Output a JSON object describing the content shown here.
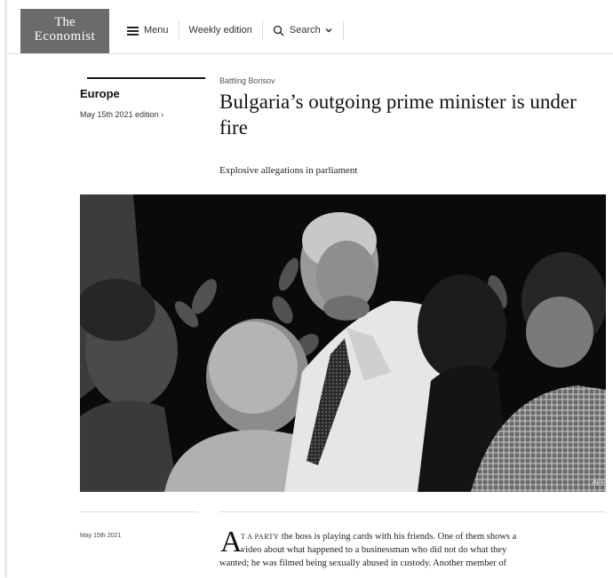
{
  "header": {
    "logo_line1": "The",
    "logo_line2": "Economist",
    "menu_label": "Menu",
    "weekly_label": "Weekly edition",
    "search_label": "Search"
  },
  "section": {
    "name": "Europe",
    "edition": "May 15th 2021 edition ›"
  },
  "article": {
    "rubric": "Battling Borisov",
    "headline": "Bulgaria’s outgoing prime minister is under fire",
    "standfirst": "Explosive allegations in parliament",
    "photo_credit": "AFP",
    "date": "May 15th 2021",
    "dropcap": "A",
    "smallcaps_lead": "T A PARTY",
    "line1_rest": " the boss is playing cards with his friends. One of them shows a",
    "line2": "video about what happened to a businessman who did not do what they",
    "line3": "wanted; he was filmed being sexually abused in custody. Another member of"
  },
  "colors": {
    "logo_bg": "#6b6b6b",
    "text": "#121212"
  }
}
